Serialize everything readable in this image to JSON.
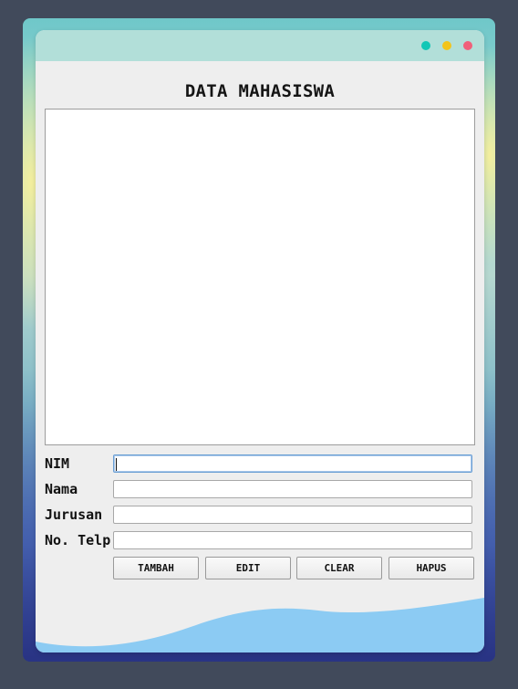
{
  "window": {
    "title": "DATA MAHASISWA"
  },
  "colors": {
    "titlebar": "#b2dfd9",
    "dot_green": "#12c7b6",
    "dot_yellow": "#f3c41a",
    "dot_red": "#f0607a",
    "wave": "#8ccbf3"
  },
  "form": {
    "fields": [
      {
        "label": "NIM",
        "value": ""
      },
      {
        "label": "Nama",
        "value": ""
      },
      {
        "label": "Jurusan",
        "value": ""
      },
      {
        "label": "No. Telp",
        "value": ""
      }
    ]
  },
  "buttons": {
    "add": "TAMBAH",
    "edit": "EDIT",
    "clear": "CLEAR",
    "delete": "HAPUS"
  }
}
